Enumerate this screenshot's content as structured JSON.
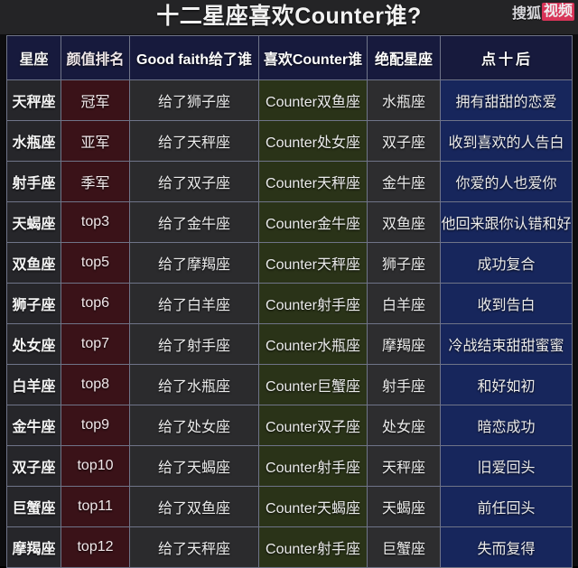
{
  "banner": {
    "title": "十二星座喜欢Counter谁?",
    "watermark_text": "搜狐",
    "watermark_badge": "视频",
    "badge_color": "#e8365d"
  },
  "table": {
    "headers": [
      "星座",
      "颜值排名",
      "Good faith给了谁",
      "喜欢Counter谁",
      "绝配星座",
      "点"
    ],
    "header_last_suffix": "后",
    "header_last_plus": "十",
    "column_colors": {
      "sign": "#26262a",
      "rank": "#3a1218",
      "gave": "#2b2b2d",
      "counter": "#2a3318",
      "match": "#2d2d2f",
      "after": "#17265c",
      "header": "#171a3d"
    },
    "rows": [
      {
        "sign": "天秤座",
        "rank": "冠军",
        "gave": "给了狮子座",
        "counter": "Counter双鱼座",
        "match": "水瓶座",
        "after": "拥有甜甜的恋爱"
      },
      {
        "sign": "水瓶座",
        "rank": "亚军",
        "gave": "给了天秤座",
        "counter": "Counter处女座",
        "match": "双子座",
        "after": "收到喜欢的人告白"
      },
      {
        "sign": "射手座",
        "rank": "季军",
        "gave": "给了双子座",
        "counter": "Counter天秤座",
        "match": "金牛座",
        "after": "你爱的人也爱你"
      },
      {
        "sign": "天蝎座",
        "rank": "top3",
        "gave": "给了金牛座",
        "counter": "Counter金牛座",
        "match": "双鱼座",
        "after": "他回来跟你认错和好"
      },
      {
        "sign": "双鱼座",
        "rank": "top5",
        "gave": "给了摩羯座",
        "counter": "Counter天秤座",
        "match": "狮子座",
        "after": "成功复合"
      },
      {
        "sign": "狮子座",
        "rank": "top6",
        "gave": "给了白羊座",
        "counter": "Counter射手座",
        "match": "白羊座",
        "after": "收到告白"
      },
      {
        "sign": "处女座",
        "rank": "top7",
        "gave": "给了射手座",
        "counter": "Counter水瓶座",
        "match": "摩羯座",
        "after": "冷战结束甜甜蜜蜜"
      },
      {
        "sign": "白羊座",
        "rank": "top8",
        "gave": "给了水瓶座",
        "counter": "Counter巨蟹座",
        "match": "射手座",
        "after": "和好如初"
      },
      {
        "sign": "金牛座",
        "rank": "top9",
        "gave": "给了处女座",
        "counter": "Counter双子座",
        "match": "处女座",
        "after": "暗恋成功"
      },
      {
        "sign": "双子座",
        "rank": "top10",
        "gave": "给了天蝎座",
        "counter": "Counter射手座",
        "match": "天秤座",
        "after": "旧爱回头"
      },
      {
        "sign": "巨蟹座",
        "rank": "top11",
        "gave": "给了双鱼座",
        "counter": "Counter天蝎座",
        "match": "天蝎座",
        "after": "前任回头"
      },
      {
        "sign": "摩羯座",
        "rank": "top12",
        "gave": "给了天秤座",
        "counter": "Counter射手座",
        "match": "巨蟹座",
        "after": "失而复得"
      }
    ]
  }
}
